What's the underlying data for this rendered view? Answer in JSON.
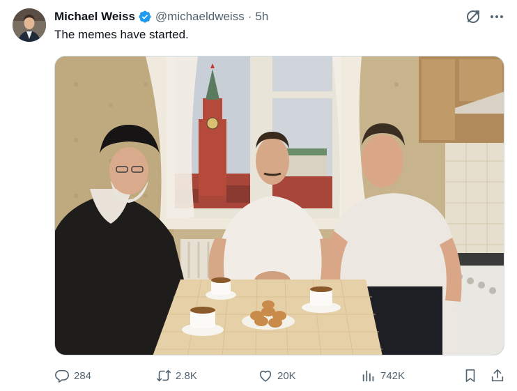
{
  "author": {
    "name": "Michael Weiss",
    "handle": "@michaeldweiss",
    "separator": "·",
    "time": "5h",
    "verified": true
  },
  "tweet": {
    "text": "The memes have started."
  },
  "media": {
    "icon": "photo",
    "scene": "kitchen-table-with-tea-and-cookies-window-kremlin-view"
  },
  "actions": {
    "replies": "284",
    "reposts": "2.8K",
    "likes": "20K",
    "views": "742K"
  },
  "icons": {
    "grok": "grok-icon",
    "more": "more-icon",
    "reply": "reply-icon",
    "repost": "repost-icon",
    "like": "heart-icon",
    "views": "views-icon",
    "bookmark": "bookmark-icon",
    "share": "share-icon"
  },
  "colors": {
    "text": "#0f1419",
    "secondary": "#536471",
    "verified": "#1d9bf0"
  }
}
